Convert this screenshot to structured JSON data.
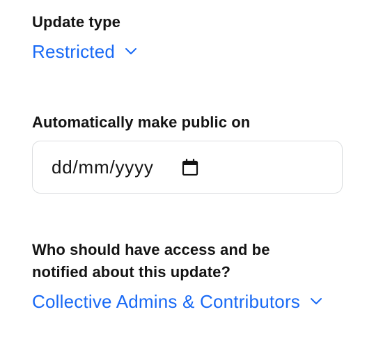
{
  "update_type": {
    "label": "Update type",
    "value": "Restricted",
    "chevron_icon": "chevron-down-icon"
  },
  "auto_public": {
    "label": "Automatically make public on",
    "date_value": "dd/mm/yyyy",
    "calendar_icon": "calendar-icon"
  },
  "access": {
    "label": "Who should have access and be notified about this update?",
    "value": "Collective Admins & Contributors",
    "chevron_icon": "chevron-down-icon"
  },
  "colors": {
    "accent": "#1869f5",
    "text": "#141414",
    "border": "#dcdee0"
  }
}
